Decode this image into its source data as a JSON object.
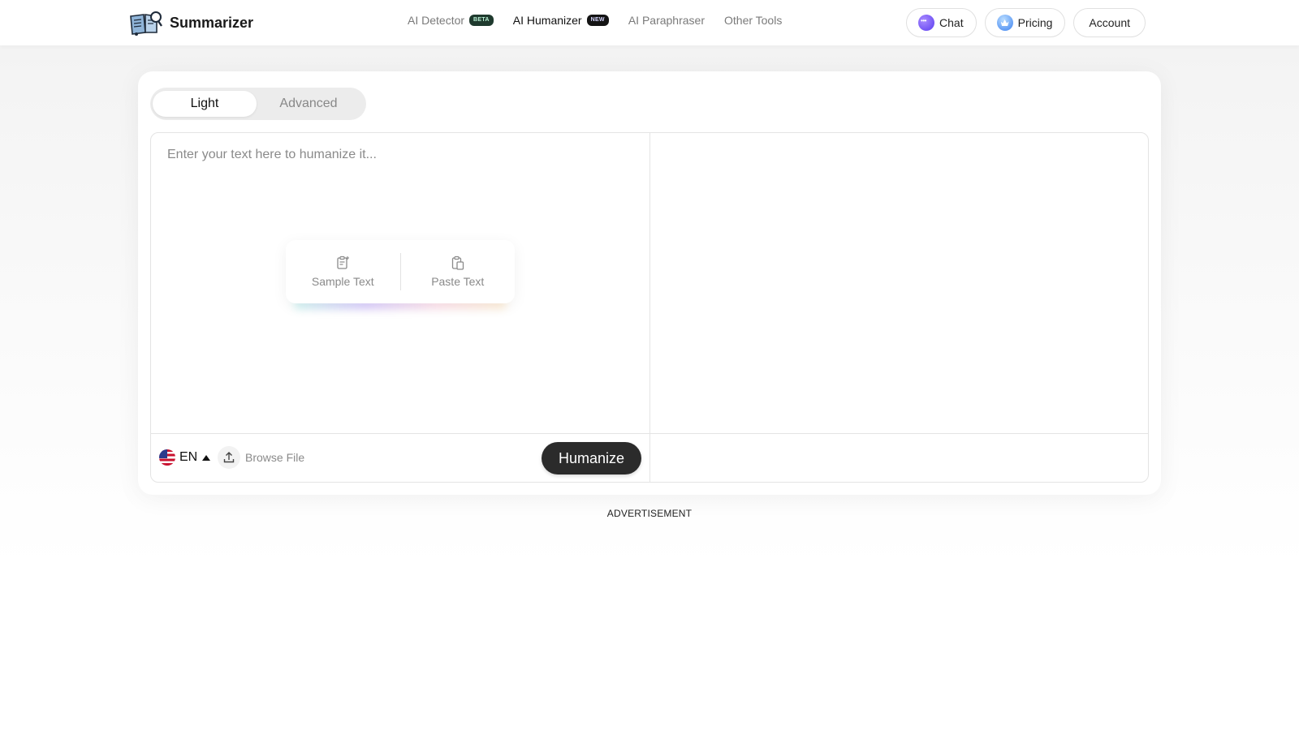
{
  "header": {
    "brand_name": "Summarizer",
    "nav": [
      {
        "label": "AI Detector",
        "badge": "BETA"
      },
      {
        "label": "AI Humanizer",
        "badge": "NEW",
        "active": true
      },
      {
        "label": "AI Paraphraser"
      },
      {
        "label": "Other Tools"
      }
    ],
    "actions": {
      "chat_label": "Chat",
      "pricing_label": "Pricing",
      "account_label": "Account"
    }
  },
  "mode_toggle": {
    "options": [
      "Light",
      "Advanced"
    ],
    "selected": "Light"
  },
  "editor": {
    "input_placeholder": "Enter your text here to humanize it...",
    "input_value": "",
    "quick_actions": {
      "sample_label": "Sample Text",
      "paste_label": "Paste Text"
    },
    "language": {
      "code": "EN",
      "flag": "us-flag-icon"
    },
    "browse_label": "Browse File",
    "humanize_label": "Humanize"
  },
  "ad_label": "ADVERTISEMENT",
  "colors": {
    "primary_button": "#2b2b2b",
    "beta_badge": "#1f3a2e",
    "new_badge": "#141414"
  }
}
